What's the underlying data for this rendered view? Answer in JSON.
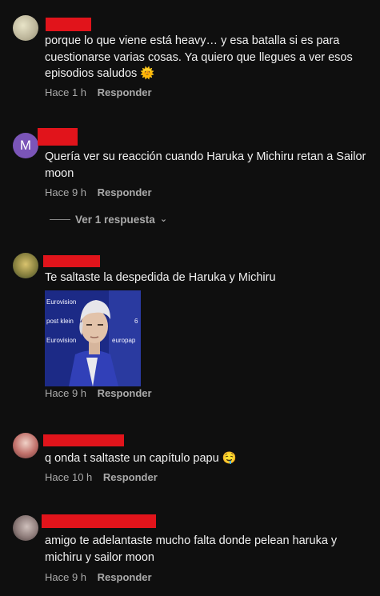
{
  "comments": [
    {
      "text": "porque lo que viene está heavy… y esa batalla si es para cuestionarse varias cosas. Ya quiero que llegues a ver esos episodios saludos 🌞",
      "time": "Hace 1 h",
      "reply": "Responder"
    },
    {
      "avatar_letter": "M",
      "text": "Quería ver su reacción cuando Haruka y Michiru retan a Sailor moon",
      "time": "Hace 9 h",
      "reply": "Responder",
      "replies_label": "Ver 1 respuesta"
    },
    {
      "text": "Te saltaste la despedida de Haruka y Michiru",
      "time": "Hace 9 h",
      "reply": "Responder",
      "gif_texts": [
        "Eurovision",
        "post klein",
        "Eurovision",
        "europap",
        "6"
      ]
    },
    {
      "text": "q onda t saltaste un capítulo papu 🤤",
      "time": "Hace 10 h",
      "reply": "Responder"
    },
    {
      "text": "amigo te adelantaste mucho falta donde pelean haruka y michiru y sailor moon",
      "time": "Hace 9 h",
      "reply": "Responder"
    }
  ],
  "colors": {
    "background": "#0f0f0f",
    "text": "#f1f1f1",
    "secondary": "#aaaaaa",
    "redaction": "#e1141b",
    "avatar_purple": "#7b55b8"
  }
}
